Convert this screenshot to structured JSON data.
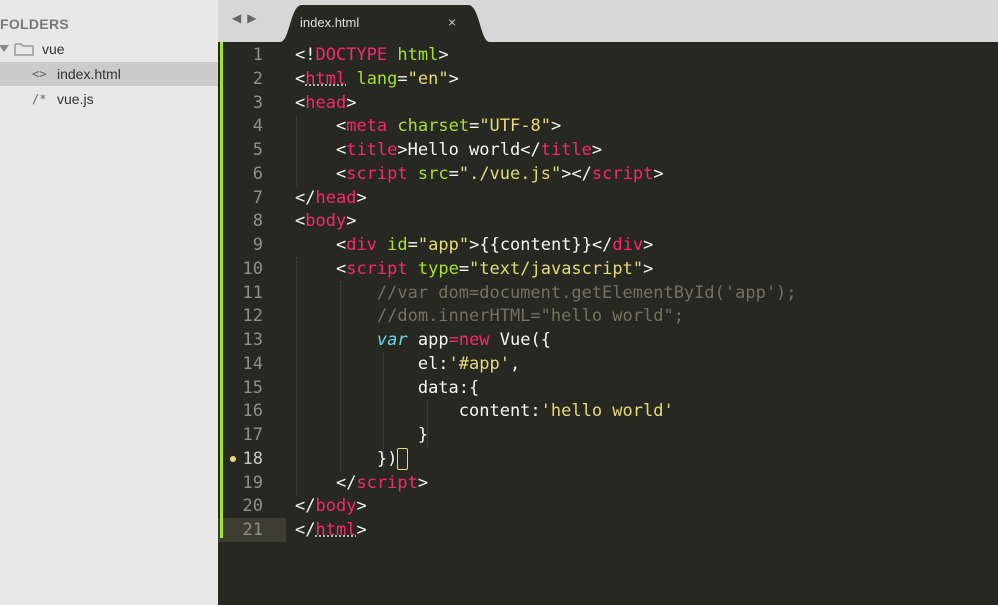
{
  "sidebar": {
    "title": "FOLDERS",
    "folder": {
      "name": "vue",
      "icon": "folder-icon"
    },
    "files": [
      {
        "icon_glyph": "<>",
        "name": "index.html",
        "selected": true
      },
      {
        "icon_glyph": "/*",
        "name": "vue.js",
        "selected": false
      }
    ]
  },
  "tabbar": {
    "back": "◀",
    "forward": "▶",
    "tab": {
      "label": "index.html",
      "close": "×"
    }
  },
  "editor": {
    "current_line": 18,
    "line_numbers": [
      "1",
      "2",
      "3",
      "4",
      "5",
      "6",
      "7",
      "8",
      "9",
      "10",
      "11",
      "12",
      "13",
      "14",
      "15",
      "16",
      "17",
      "18",
      "19",
      "20",
      "21"
    ],
    "code": {
      "l1": {
        "p0": "<!",
        "doctype": "DOCTYPE",
        "sp": " ",
        "html": "html",
        "p1": ">"
      },
      "l2": {
        "p0": "<",
        "tag": "html",
        "sp": " ",
        "attr": "lang",
        "eq": "=",
        "val": "\"en\"",
        "p1": ">"
      },
      "l3": {
        "p0": "<",
        "tag": "head",
        "p1": ">"
      },
      "l4": {
        "ind": "    ",
        "p0": "<",
        "tag": "meta",
        "sp": " ",
        "attr": "charset",
        "eq": "=",
        "val": "\"UTF-8\"",
        "p1": ">"
      },
      "l5": {
        "ind": "    ",
        "p0": "<",
        "tag": "title",
        "p1": ">",
        "text": "Hello world",
        "p2": "</",
        "tag2": "title",
        "p3": ">"
      },
      "l6": {
        "ind": "    ",
        "p0": "<",
        "tag": "script",
        "sp": " ",
        "attr": "src",
        "eq": "=",
        "val": "\"./vue.js\"",
        "p1": "></",
        "tag2": "script",
        "p2": ">"
      },
      "l7": {
        "p0": "</",
        "tag": "head",
        "p1": ">"
      },
      "l8": {
        "p0": "<",
        "tag": "body",
        "p1": ">"
      },
      "l9": {
        "ind": "    ",
        "p0": "<",
        "tag": "div",
        "sp": " ",
        "attr": "id",
        "eq": "=",
        "val": "\"app\"",
        "p1": ">",
        "text": "{{content}}",
        "p2": "</",
        "tag2": "div",
        "p3": ">"
      },
      "l10": {
        "ind": "    ",
        "p0": "<",
        "tag": "script",
        "sp": " ",
        "attr": "type",
        "eq": "=",
        "val": "\"text/javascript\"",
        "p1": ">"
      },
      "l11": {
        "ind": "        ",
        "comment": "//var dom=document.getElementById('app');"
      },
      "l12": {
        "ind": "        ",
        "comment": "//dom.innerHTML=\"hello world\";"
      },
      "l13": {
        "ind": "        ",
        "kw": "var",
        "sp": " ",
        "name": "app",
        "op": "=",
        "kw2": "new",
        "rest": " Vue({"
      },
      "l14": {
        "ind": "            ",
        "key": "el:",
        "str": "'#app'",
        "rest": ","
      },
      "l15": {
        "ind": "            ",
        "text": "data:{"
      },
      "l16": {
        "ind": "                ",
        "key": "content:",
        "str": "'hello world'"
      },
      "l17": {
        "ind": "            ",
        "text": "}"
      },
      "l18": {
        "ind": "        ",
        "text": "})"
      },
      "l19": {
        "ind": "    ",
        "p0": "</",
        "tag": "script",
        "p1": ">"
      },
      "l20": {
        "p0": "</",
        "tag": "body",
        "p1": ">"
      },
      "l21": {
        "p0": "</",
        "tag": "html",
        "p1": ">"
      }
    }
  },
  "colors": {
    "tag": "#f92672",
    "attr": "#a6e22e",
    "string": "#e6db74",
    "comment": "#75715e",
    "keyword": "#66d9ef",
    "background": "#272822",
    "sidebar": "#e8e8e8"
  }
}
